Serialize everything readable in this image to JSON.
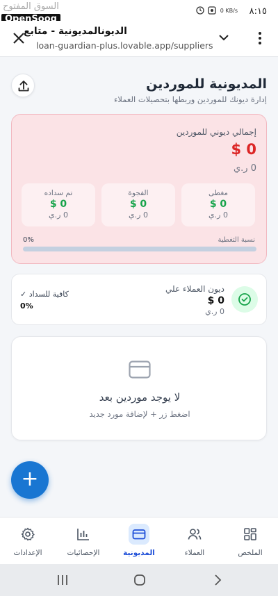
{
  "status_bar": {
    "time": "٨:١٥",
    "watermark_arabic": "السوق المفتوح",
    "watermark_brand": "OpenSooq",
    "speed": "0 KB/s"
  },
  "browser": {
    "page_title": "الديونالمديونية - متابع",
    "url": "loan-guardian-plus.lovable.app/suppliers"
  },
  "header": {
    "title": "المديونية للموردين",
    "subtitle": "إدارة ديونك للموردين وربطها بتحصيلات العملاء"
  },
  "summary": {
    "total_label": "إجمالي ديوني للموردين",
    "total_amount": "$ 0",
    "total_sub": "0 ر.ي",
    "cards": [
      {
        "label": "مغطى",
        "amount": "$ 0",
        "sub": "0 ر.ي"
      },
      {
        "label": "الفجوة",
        "amount": "$ 0",
        "sub": "0 ر.ي"
      },
      {
        "label": "تم سداده",
        "amount": "$ 0",
        "sub": "0 ر.ي"
      }
    ],
    "coverage_label": "نسبة التغطية",
    "coverage_percent": "0%",
    "coverage_fraction": 0
  },
  "customers_debt": {
    "label": "ديون العملاء علي",
    "amount": "$ 0",
    "sub": "0 ر.ي",
    "sufficiency_label": "كافية للسداد ✓",
    "sufficiency_percent": "0%"
  },
  "empty_state": {
    "title": "لا يوجد موردين بعد",
    "subtitle": "اضغط زر + لإضافة مورد جديد"
  },
  "fab": {
    "label": "+"
  },
  "bottom_nav": {
    "items": [
      {
        "label": "الملخص",
        "icon": "dashboard-icon"
      },
      {
        "label": "العملاء",
        "icon": "users-icon"
      },
      {
        "label": "المديونية",
        "icon": "card-icon",
        "active": true
      },
      {
        "label": "الإحصائيات",
        "icon": "bar-chart-icon"
      },
      {
        "label": "الإعدادات",
        "icon": "gear-icon"
      }
    ]
  },
  "colors": {
    "accent": "#1976d2",
    "danger": "#dc2626",
    "success": "#16a34a",
    "summary_bg": "#fbe3e6"
  }
}
